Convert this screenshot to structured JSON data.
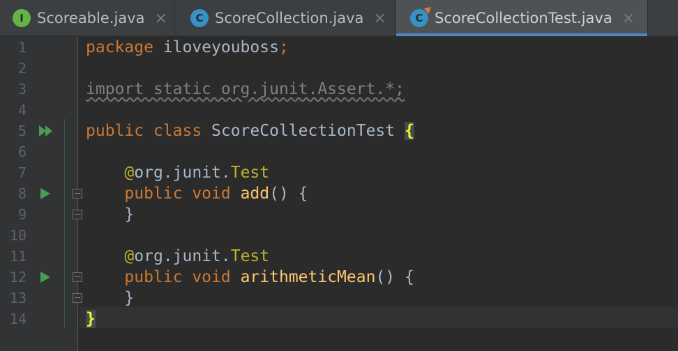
{
  "tabs": [
    {
      "icon": "interface-icon",
      "icon_letter": "I",
      "label": "Scoreable.java",
      "active": false
    },
    {
      "icon": "class-icon",
      "icon_letter": "C",
      "label": "ScoreCollection.java",
      "active": false
    },
    {
      "icon": "test-class-icon",
      "icon_letter": "C",
      "label": "ScoreCollectionTest.java",
      "active": true
    }
  ],
  "close_glyph": "×",
  "lines": [
    {
      "n": "1",
      "segments": [
        [
          "kw",
          "package"
        ],
        [
          "plain",
          " iloveyouboss"
        ],
        [
          "kw",
          ";"
        ]
      ]
    },
    {
      "n": "2",
      "segments": []
    },
    {
      "n": "3",
      "segments": [
        [
          "unused",
          "import static org.junit.Assert.*;"
        ]
      ]
    },
    {
      "n": "4",
      "segments": []
    },
    {
      "n": "5",
      "segments": [
        [
          "kw",
          "public class"
        ],
        [
          "plain",
          " ScoreCollectionTest "
        ],
        [
          "brace",
          "{"
        ]
      ],
      "gutter": "run-all"
    },
    {
      "n": "6",
      "segments": []
    },
    {
      "n": "7",
      "segments": [
        [
          "plain",
          "    "
        ],
        [
          "ann",
          "@"
        ],
        [
          "plain",
          "org.junit."
        ],
        [
          "ann",
          "Test"
        ]
      ]
    },
    {
      "n": "8",
      "segments": [
        [
          "plain",
          "    "
        ],
        [
          "kw",
          "public void"
        ],
        [
          "plain",
          " "
        ],
        [
          "fn",
          "add"
        ],
        [
          "plain",
          "() {"
        ]
      ],
      "gutter": "run",
      "fold": true
    },
    {
      "n": "9",
      "segments": [
        [
          "plain",
          "    }"
        ]
      ],
      "fold": true
    },
    {
      "n": "10",
      "segments": []
    },
    {
      "n": "11",
      "segments": [
        [
          "plain",
          "    "
        ],
        [
          "ann",
          "@"
        ],
        [
          "plain",
          "org.junit."
        ],
        [
          "ann",
          "Test"
        ]
      ]
    },
    {
      "n": "12",
      "segments": [
        [
          "plain",
          "    "
        ],
        [
          "kw",
          "public void"
        ],
        [
          "plain",
          " "
        ],
        [
          "fn",
          "arithmeticMean"
        ],
        [
          "plain",
          "() {"
        ]
      ],
      "gutter": "run",
      "fold": true
    },
    {
      "n": "13",
      "segments": [
        [
          "plain",
          "    }"
        ]
      ],
      "fold": true
    },
    {
      "n": "14",
      "segments": [
        [
          "brace",
          "}"
        ]
      ]
    }
  ],
  "colors": {
    "keyword": "#cc7832",
    "annotation": "#bbb529",
    "method": "#ffc66d",
    "text": "#a9b7c6",
    "run": "#499c54",
    "active_tab_underline": "#4a88c7"
  }
}
